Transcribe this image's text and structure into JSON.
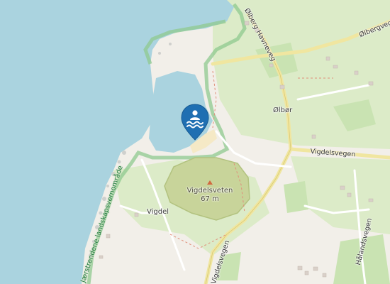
{
  "map": {
    "places": {
      "olbor": "Ølbør",
      "vigdel": "Vigdel"
    },
    "roads": {
      "olberg_havneveg": "Ølberg Havneveg",
      "olbergvegen": "Ølbergvegen",
      "vigdelsvegen_east": "Vigdelsvegen",
      "vigdelsvegen_south": "Vigdelsvegen",
      "halandsvegen": "Hålandsvegen"
    },
    "peak": {
      "name": "Vigdelsveten",
      "elevation": "67 m"
    },
    "protected_area": {
      "name": "Jærstrendene landskapsvernområde"
    },
    "marker": {
      "type": "beach-swimming",
      "icon": "swimmer-icon",
      "color": "#1f6fb2"
    },
    "colors": {
      "water": "#aad3df",
      "land": "#f2efe9",
      "grass": "#cdebb0",
      "park_border": "#8fc98f",
      "sand": "#f5e9c6",
      "peak_area": "#c8d49a"
    }
  }
}
